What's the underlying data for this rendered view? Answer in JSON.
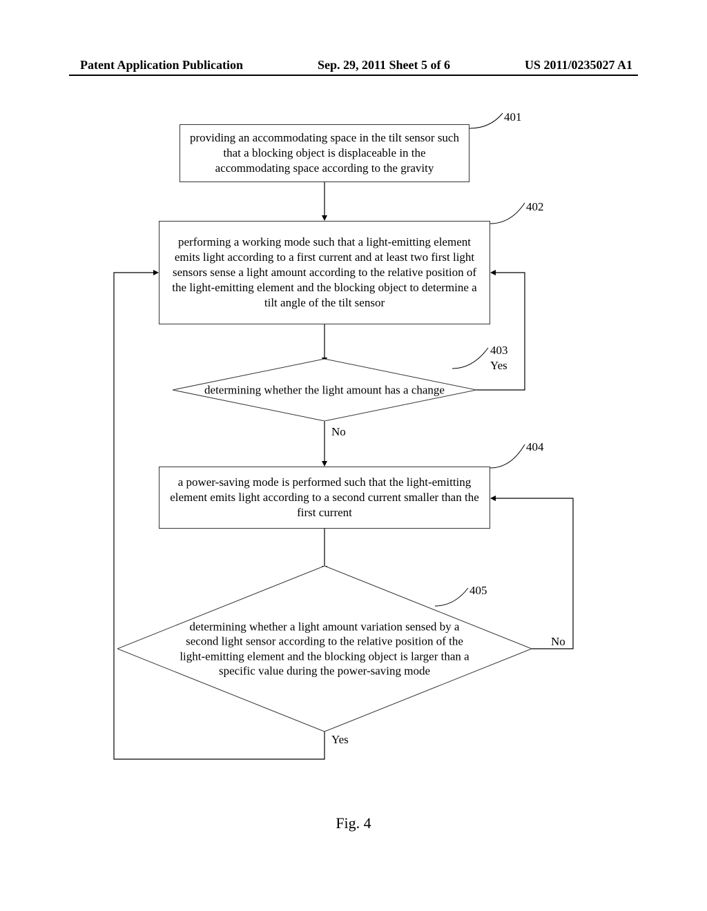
{
  "header": {
    "left": "Patent Application Publication",
    "center": "Sep. 29, 2011  Sheet 5 of 6",
    "right": "US 2011/0235027 A1"
  },
  "labels": {
    "s401": "401",
    "s402": "402",
    "s403": "403",
    "s404": "404",
    "s405": "405"
  },
  "steps": {
    "b401": "providing an accommodating space in the tilt sensor such that a blocking object is displaceable in the accommodating space according to the gravity",
    "b402": "performing a working mode such that a light-emitting element emits light according to a first current and at least two first light sensors sense a light amount according to the relative position of the light-emitting element and the blocking object to determine a tilt angle of the tilt sensor",
    "d403": "determining whether the light amount has a change",
    "b404": "a power-saving mode is performed such that the light-emitting element emits light according to a second current smaller than the first current",
    "d405": "determining whether a light amount variation sensed by a second light sensor according to the relative position of the light-emitting element and the blocking object is larger than a specific value during the power-saving mode"
  },
  "branches": {
    "yes": "Yes",
    "no": "No"
  },
  "figure_caption": "Fig. 4"
}
